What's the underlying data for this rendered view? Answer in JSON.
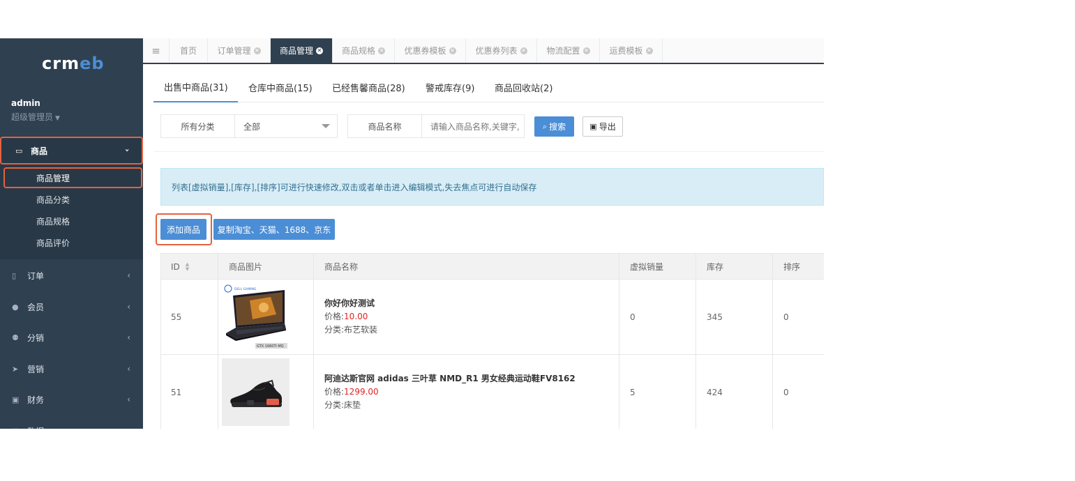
{
  "sidebar": {
    "logo_main": "crm",
    "logo_accent": "eb",
    "user_name": "admin",
    "user_role": "超级管理员",
    "active_menu": "商品",
    "submenu": [
      "商品管理",
      "商品分类",
      "商品规格",
      "商品评价"
    ],
    "menu": [
      "订单",
      "会员",
      "分销",
      "营销",
      "财务",
      "数据"
    ]
  },
  "tabs": [
    "首页",
    "订单管理",
    "商品管理",
    "商品规格",
    "优惠券模板",
    "优惠券列表",
    "物流配置",
    "运费模板"
  ],
  "subtabs": [
    "出售中商品(31)",
    "仓库中商品(15)",
    "已经售馨商品(28)",
    "警戒库存(9)",
    "商品回收站(2)"
  ],
  "filter": {
    "category_label": "所有分类",
    "category_value": "全部",
    "name_label": "商品名称",
    "name_placeholder": "请输入商品名称,关键字,",
    "search_label": "搜索",
    "export_label": "导出"
  },
  "notice": "列表[虚拟销量],[库存],[排序]可进行快速修改,双击或者单击进入编辑模式,失去焦点可进行自动保存",
  "actions": {
    "add": "添加商品",
    "copy": "复制淘宝、天猫、1688、京东"
  },
  "table": {
    "headers": [
      "ID",
      "商品图片",
      "商品名称",
      "虚拟销量",
      "库存",
      "排序"
    ],
    "price_prefix": "价格:",
    "category_prefix": "分类:",
    "rows": [
      {
        "id": "55",
        "name": "你好你好测试",
        "price": "10.00",
        "category": "布艺软装",
        "sales": "0",
        "stock": "345",
        "sort": "0",
        "image": "laptop",
        "image_text_top": "DELL GAMING",
        "image_text_bottom": "GTX 1660Ti MQ"
      },
      {
        "id": "51",
        "name": "阿迪达斯官网 adidas 三叶草 NMD_R1 男女经典运动鞋FV8162",
        "price": "1299.00",
        "category": "床垫",
        "sales": "5",
        "stock": "424",
        "sort": "0",
        "image": "shoe"
      }
    ]
  }
}
